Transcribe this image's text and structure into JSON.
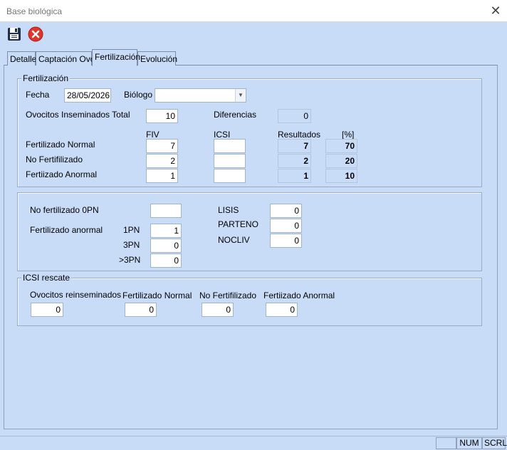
{
  "window": {
    "title": "Base biológica",
    "close_glyph": "✕"
  },
  "toolbar": {
    "save_icon": "save-icon",
    "cancel_icon": "cancel-icon"
  },
  "tabs": [
    "Detalle",
    "Captación Ovo",
    "Fertilización",
    "Evolución"
  ],
  "fertilizacion": {
    "legend": "Fertilización",
    "fecha_label": "Fecha",
    "fecha_value": "28/05/2026",
    "biologo_label": "Biólogo",
    "biologo_value": "",
    "ovocitos_label": "Ovocitos Inseminados Total",
    "ovocitos_value": "10",
    "diferencias_label": "Diferencias",
    "diferencias_value": "0",
    "headers": {
      "fiv": "FIV",
      "icsi": "ICSI",
      "resultados": "Resultados",
      "pct": "[%]"
    },
    "rows": [
      {
        "label": "Fertilizado Normal",
        "fiv": "7",
        "icsi": "",
        "resultado": "7",
        "pct": "70"
      },
      {
        "label": "No Fertifilizado",
        "fiv": "2",
        "icsi": "",
        "resultado": "2",
        "pct": "20"
      },
      {
        "label": "Fertiizado Anormal",
        "fiv": "1",
        "icsi": "",
        "resultado": "1",
        "pct": "10"
      }
    ]
  },
  "detalle": {
    "no_fert_label": "No fertilizado 0PN",
    "no_fert_value": "",
    "fert_anormal_label": "Fertilizado anormal",
    "pn": [
      {
        "label": "1PN",
        "value": "1"
      },
      {
        "label": "3PN",
        "value": "0"
      },
      {
        "label": ">3PN",
        "value": "0"
      }
    ],
    "right": [
      {
        "label": "LISIS",
        "value": "0"
      },
      {
        "label": "PARTENO",
        "value": "0"
      },
      {
        "label": "NOCLIV",
        "value": "0"
      }
    ]
  },
  "rescate": {
    "legend": "ICSI rescate",
    "cols": [
      {
        "label": "Ovocitos reinseminados",
        "value": "0"
      },
      {
        "label": "Fertilizado Normal",
        "value": "0"
      },
      {
        "label": "No Fertifilizado",
        "value": "0"
      },
      {
        "label": "Fertiizado Anormal",
        "value": "0"
      }
    ]
  },
  "status": {
    "num": "NUM",
    "scrl": "SCRL"
  },
  "colors": {
    "background": "#c9dcf7",
    "cancel_red": "#e0352b"
  }
}
